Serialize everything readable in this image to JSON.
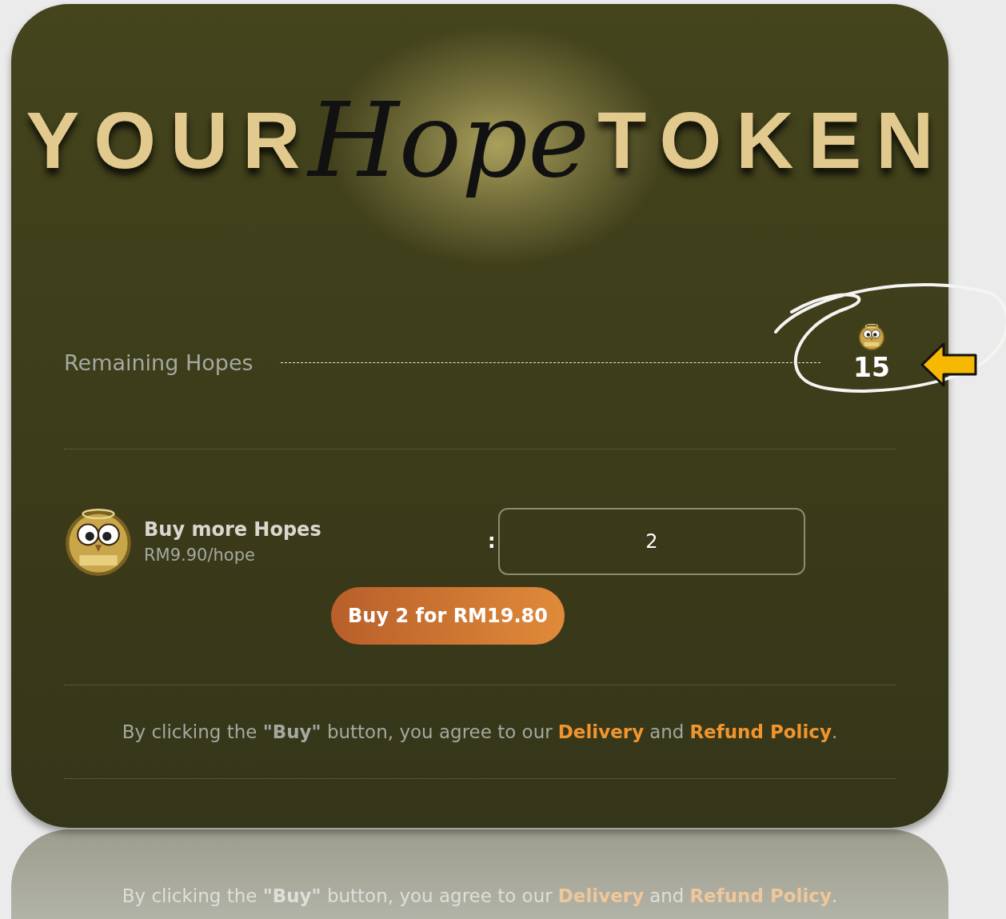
{
  "title": {
    "left": "YOUR",
    "script": "Hope",
    "right": "TOKEN"
  },
  "balance": {
    "label": "Remaining Hopes",
    "value": "15"
  },
  "purchase": {
    "title": "Buy more Hopes",
    "price": "RM9.90/hope",
    "separator": ":",
    "quantity": "2",
    "button": "Buy 2 for RM19.80"
  },
  "terms": {
    "before": "By clicking the **\"Buy\"** button, you agree to our",
    "link_1": "Delivery",
    "middle": "and",
    "link_2": "Refund Policy",
    "end": "."
  },
  "reflection": {
    "before": "By clicking the **\"Buy\"** button, you agree to our",
    "link_1": "Delivery",
    "middle": "and",
    "link_2": "Refund Policy",
    "end": "."
  }
}
